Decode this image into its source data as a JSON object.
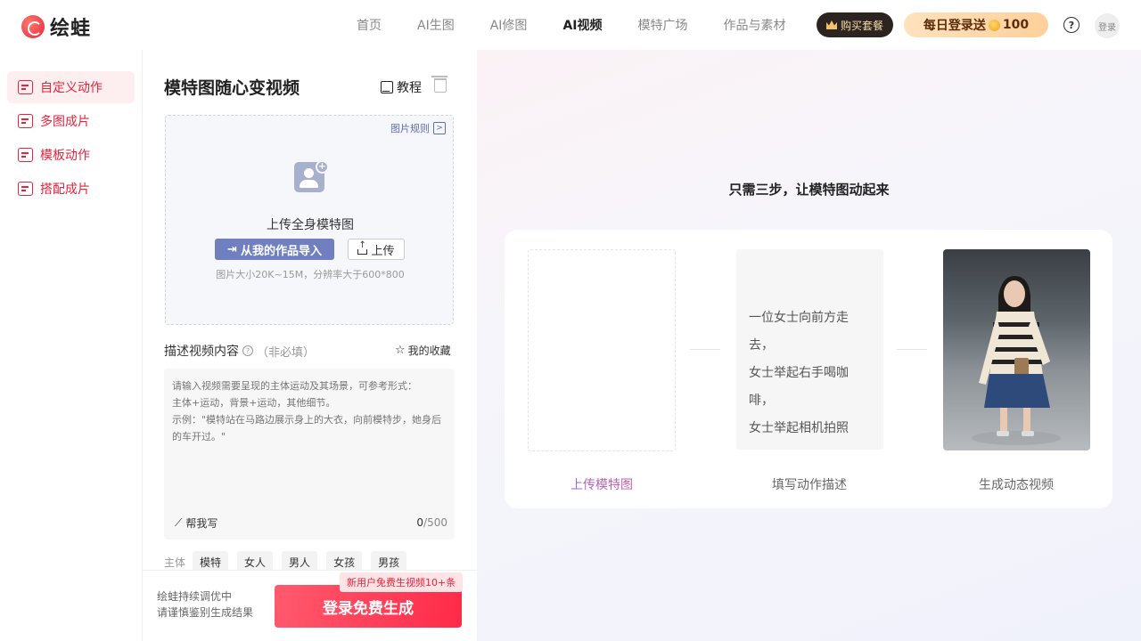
{
  "app": {
    "name": "绘蛙"
  },
  "nav": {
    "items": [
      {
        "label": "首页",
        "active": false
      },
      {
        "label": "AI生图",
        "active": false
      },
      {
        "label": "AI修图",
        "active": false
      },
      {
        "label": "AI视频",
        "active": true
      },
      {
        "label": "模特广场",
        "active": false
      },
      {
        "label": "作品与素材",
        "active": false
      }
    ]
  },
  "header": {
    "buy_label": "购买套餐",
    "daily_label": "每日登录送",
    "daily_amount": "100",
    "help": "?",
    "login": "登录"
  },
  "sidebar": {
    "items": [
      {
        "label": "自定义动作",
        "active": true
      },
      {
        "label": "多图成片",
        "active": false
      },
      {
        "label": "模板动作",
        "active": false
      },
      {
        "label": "搭配成片",
        "active": false
      }
    ]
  },
  "panel": {
    "title": "模特图随心变视频",
    "tutorial": "教程",
    "upload": {
      "rule_link": "图片规则",
      "label": "上传全身模特图",
      "import_btn": "从我的作品导入",
      "upload_btn": "上传",
      "hint": "图片大小20K~15M，分辨率大于600*800"
    },
    "desc": {
      "label": "描述视频内容",
      "optional": "（非必填）",
      "favorites": "我的收藏",
      "placeholder": "请输入视频需要呈现的主体运动及其场景，可参考形式：\n主体+运动，背景+运动，其他细节。\n示例：\"模特站在马路边展示身上的大衣，向前模特步，她身后的车开过。\"",
      "help_write": "帮我写",
      "count": "0",
      "max": "/500"
    },
    "tags": {
      "label": "主体",
      "items": [
        "模特",
        "女人",
        "男人",
        "女孩",
        "男孩"
      ]
    },
    "bottom": {
      "note_line1": "绘蛙持续调优中",
      "note_line2": "请谨慎鉴别生成结果",
      "badge": "新用户免费生视频10+条",
      "button": "登录免费生成"
    }
  },
  "right": {
    "title": "只需三步，让模特图动起来",
    "step2_lines": [
      "一位女士向前方走去，",
      "女士举起右手喝咖啡，",
      "女士举起相机拍照"
    ],
    "captions": [
      "上传模特图",
      "填写动作描述",
      "生成动态视频"
    ]
  }
}
